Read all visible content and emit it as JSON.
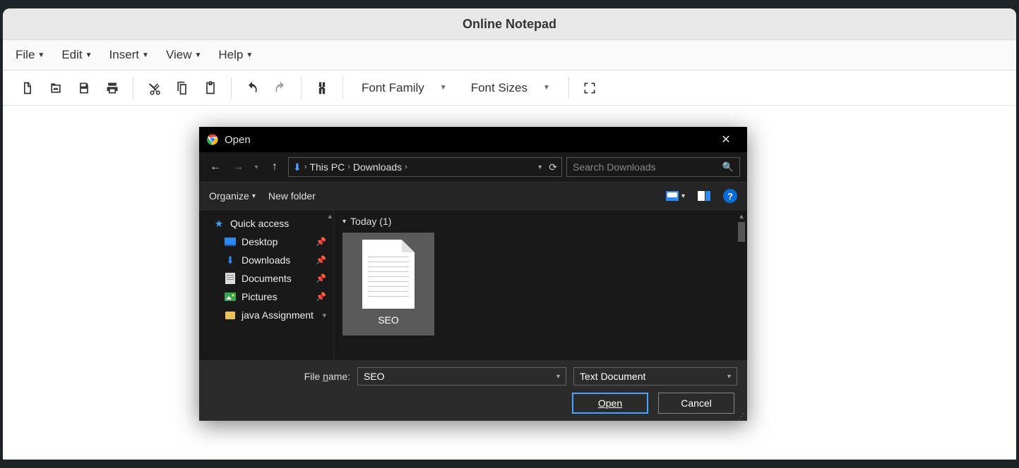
{
  "app": {
    "title": "Online Notepad"
  },
  "menu": {
    "file": "File",
    "edit": "Edit",
    "insert": "Insert",
    "view": "View",
    "help": "Help"
  },
  "toolbar": {
    "font_family_label": "Font Family",
    "font_sizes_label": "Font Sizes"
  },
  "dialog": {
    "title": "Open",
    "breadcrumb": {
      "root": "This PC",
      "folder": "Downloads"
    },
    "search_placeholder": "Search Downloads",
    "organize": "Organize",
    "new_folder": "New folder",
    "sidebar": {
      "quick_access": "Quick access",
      "desktop": "Desktop",
      "downloads": "Downloads",
      "documents": "Documents",
      "pictures": "Pictures",
      "java_assignment": "java Assignment"
    },
    "group_today": "Today (1)",
    "file_seo": "SEO",
    "filename_label_pre": "File ",
    "filename_label_ul": "n",
    "filename_label_post": "ame:",
    "filename_value": "SEO",
    "filetype": "Text Document",
    "open_btn": "Open",
    "cancel_btn": "Cancel"
  }
}
